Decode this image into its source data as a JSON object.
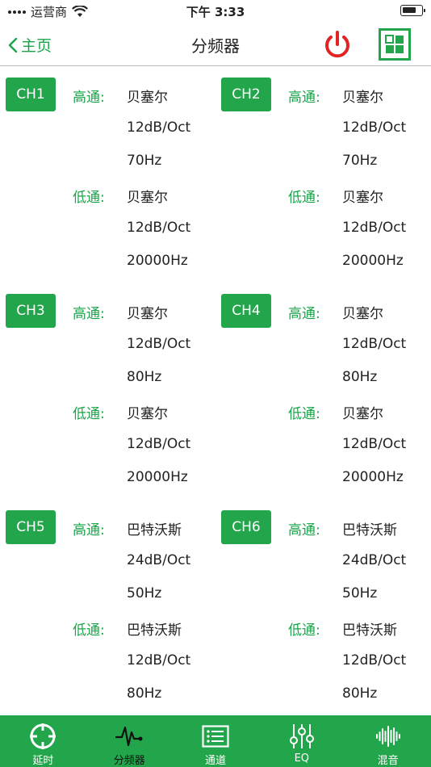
{
  "status": {
    "carrier": "运营商",
    "time": "下午 3:33",
    "battery_level": 0.75
  },
  "nav": {
    "back_label": "主页",
    "title": "分频器",
    "power_icon": "power-icon",
    "grid_icon": "grid-icon"
  },
  "channels": [
    {
      "name": "CH1",
      "high": {
        "label": "高通:",
        "type": "贝塞尔",
        "slope": "12dB/Oct",
        "freq": "70Hz"
      },
      "low": {
        "label": "低通:",
        "type": "贝塞尔",
        "slope": "12dB/Oct",
        "freq": "20000Hz"
      }
    },
    {
      "name": "CH2",
      "high": {
        "label": "高通:",
        "type": "贝塞尔",
        "slope": "12dB/Oct",
        "freq": "70Hz"
      },
      "low": {
        "label": "低通:",
        "type": "贝塞尔",
        "slope": "12dB/Oct",
        "freq": "20000Hz"
      }
    },
    {
      "name": "CH3",
      "high": {
        "label": "高通:",
        "type": "贝塞尔",
        "slope": "12dB/Oct",
        "freq": "80Hz"
      },
      "low": {
        "label": "低通:",
        "type": "贝塞尔",
        "slope": "12dB/Oct",
        "freq": "20000Hz"
      }
    },
    {
      "name": "CH4",
      "high": {
        "label": "高通:",
        "type": "贝塞尔",
        "slope": "12dB/Oct",
        "freq": "80Hz"
      },
      "low": {
        "label": "低通:",
        "type": "贝塞尔",
        "slope": "12dB/Oct",
        "freq": "20000Hz"
      }
    },
    {
      "name": "CH5",
      "high": {
        "label": "高通:",
        "type": "巴特沃斯",
        "slope": "24dB/Oct",
        "freq": "50Hz"
      },
      "low": {
        "label": "低通:",
        "type": "巴特沃斯",
        "slope": "12dB/Oct",
        "freq": "80Hz"
      }
    },
    {
      "name": "CH6",
      "high": {
        "label": "高通:",
        "type": "巴特沃斯",
        "slope": "24dB/Oct",
        "freq": "50Hz"
      },
      "low": {
        "label": "低通:",
        "type": "巴特沃斯",
        "slope": "12dB/Oct",
        "freq": "80Hz"
      }
    }
  ],
  "tabs": [
    {
      "label": "延时",
      "icon": "crosshair-icon",
      "active": false
    },
    {
      "label": "分频器",
      "icon": "waveform-pulse-icon",
      "active": true
    },
    {
      "label": "通道",
      "icon": "channel-list-icon",
      "active": false
    },
    {
      "label": "EQ",
      "icon": "sliders-icon",
      "active": false
    },
    {
      "label": "混音",
      "icon": "audio-wave-icon",
      "active": false
    }
  ],
  "colors": {
    "accent": "#23a54b",
    "power": "#e02424",
    "label_green": "#1aa54a"
  }
}
